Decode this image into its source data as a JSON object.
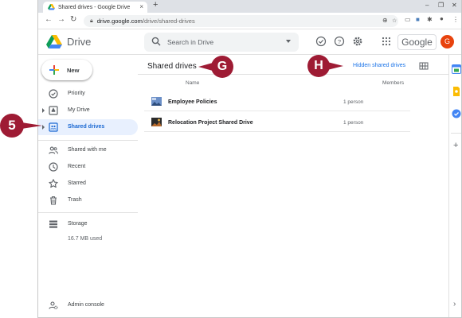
{
  "browser": {
    "tab_title": "Shared drives - Google Drive",
    "tab_close": "×",
    "new_tab": "+",
    "url_host": "drive.google.com",
    "url_path": "/drive/shared-drives"
  },
  "app": {
    "name": "Drive",
    "search_placeholder": "Search in Drive",
    "google_label": "Google",
    "avatar_initial": "G"
  },
  "sidebar": {
    "new_label": "New",
    "items": [
      {
        "label": "Priority"
      },
      {
        "label": "My Drive"
      },
      {
        "label": "Shared drives"
      },
      {
        "label": "Shared with me"
      },
      {
        "label": "Recent"
      },
      {
        "label": "Starred"
      },
      {
        "label": "Trash"
      },
      {
        "label": "Storage"
      }
    ],
    "storage_used": "16.7 MB used",
    "admin_label": "Admin console"
  },
  "main": {
    "title": "Shared drives",
    "hidden_link": "Hidden shared drives",
    "columns": {
      "name": "Name",
      "members": "Members"
    },
    "rows": [
      {
        "name": "Employee Policies",
        "members": "1 person"
      },
      {
        "name": "Relocation Project Shared Drive",
        "members": "1 person"
      }
    ]
  },
  "callouts": {
    "step": "5",
    "g": "G",
    "h": "H"
  },
  "colors": {
    "accent": "#1a73e8",
    "active_bg": "#e8f0fe",
    "callout": "#9e1b34"
  }
}
